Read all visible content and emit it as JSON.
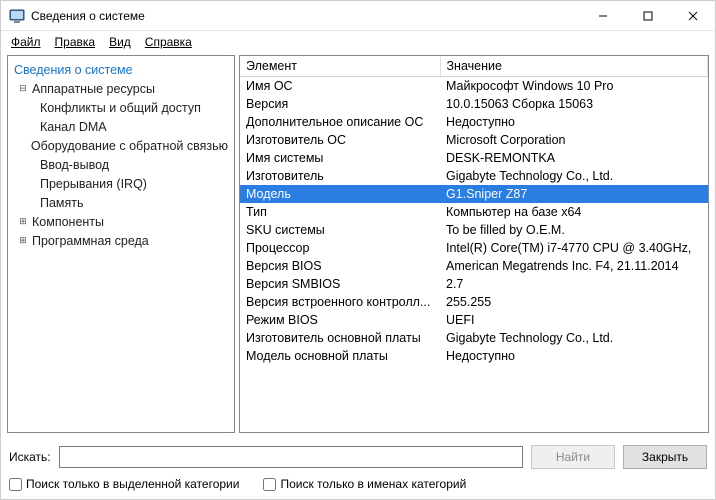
{
  "window": {
    "title": "Сведения о системе"
  },
  "menu": {
    "file": "Файл",
    "edit": "Правка",
    "view": "Вид",
    "help": "Справка"
  },
  "tree": {
    "root": "Сведения о системе",
    "hardware": "Аппаратные ресурсы",
    "hw_children": {
      "conflicts": "Конфликты и общий доступ",
      "dma": "Канал DMA",
      "hardware_feedback": "Оборудование с обратной связью",
      "io": "Ввод-вывод",
      "irq": "Прерывания (IRQ)",
      "memory": "Память"
    },
    "components": "Компоненты",
    "software_env": "Программная среда"
  },
  "table": {
    "headers": {
      "element": "Элемент",
      "value": "Значение"
    },
    "rows": [
      {
        "k": "Имя ОС",
        "v": "Майкрософт Windows 10 Pro"
      },
      {
        "k": "Версия",
        "v": "10.0.15063 Сборка 15063"
      },
      {
        "k": "Дополнительное описание ОС",
        "v": "Недоступно"
      },
      {
        "k": "Изготовитель ОС",
        "v": "Microsoft Corporation"
      },
      {
        "k": "Имя системы",
        "v": "DESK-REMONTKA"
      },
      {
        "k": "Изготовитель",
        "v": "Gigabyte Technology Co., Ltd."
      },
      {
        "k": "Модель",
        "v": "G1.Sniper Z87",
        "selected": true
      },
      {
        "k": "Тип",
        "v": "Компьютер на базе x64"
      },
      {
        "k": "SKU системы",
        "v": "To be filled by O.E.M."
      },
      {
        "k": "Процессор",
        "v": "Intel(R) Core(TM) i7-4770 CPU @ 3.40GHz,"
      },
      {
        "k": "Версия BIOS",
        "v": "American Megatrends Inc. F4, 21.11.2014"
      },
      {
        "k": "Версия SMBIOS",
        "v": "2.7"
      },
      {
        "k": "Версия встроенного контролл...",
        "v": "255.255"
      },
      {
        "k": "Режим BIOS",
        "v": "UEFI"
      },
      {
        "k": "Изготовитель основной платы",
        "v": "Gigabyte Technology Co., Ltd."
      },
      {
        "k": "Модель основной платы",
        "v": "Недоступно"
      }
    ]
  },
  "search": {
    "label": "Искать:",
    "value": "",
    "find_btn": "Найти",
    "close_btn": "Закрыть",
    "cb_selected_cat": "Поиск только в выделенной категории",
    "cb_names_only": "Поиск только в именах категорий"
  }
}
